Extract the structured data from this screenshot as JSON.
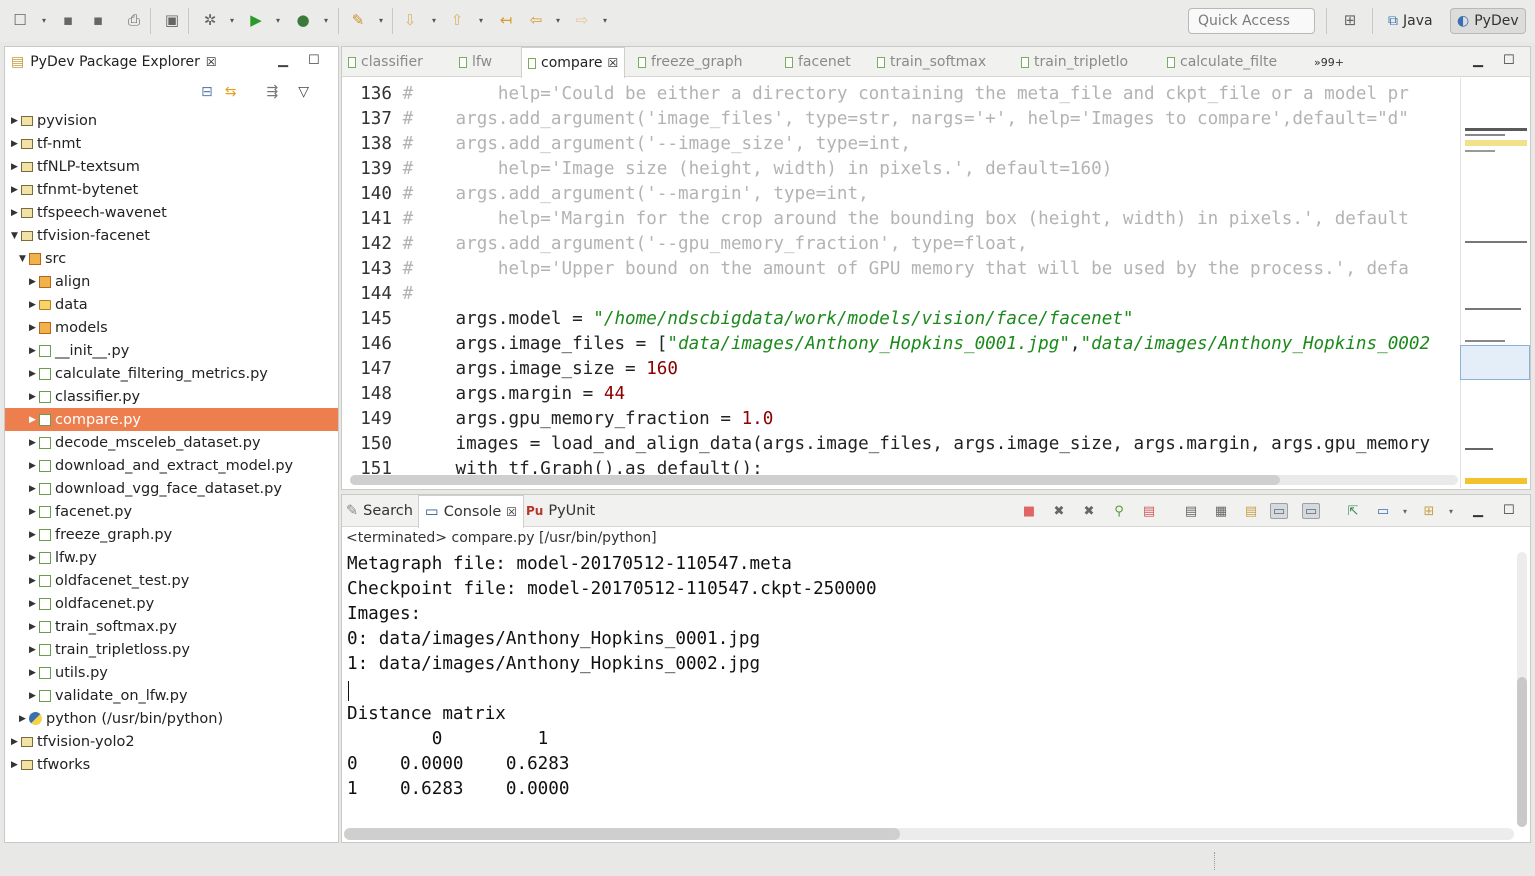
{
  "toolbar": {
    "quick_access_placeholder": "Quick Access",
    "perspectives": [
      {
        "name": "Java",
        "icon": "java-perspective-icon"
      },
      {
        "name": "PyDev",
        "icon": "pydev-perspective-icon",
        "selected": true
      }
    ]
  },
  "explorer": {
    "title": "PyDev Package Explorer",
    "tree": [
      {
        "label": "pyvision",
        "depth": 0,
        "expanded": false,
        "icon": "project"
      },
      {
        "label": "tf-nmt",
        "depth": 0,
        "expanded": false,
        "icon": "project"
      },
      {
        "label": "tfNLP-textsum",
        "depth": 0,
        "expanded": false,
        "icon": "project"
      },
      {
        "label": "tfnmt-bytenet",
        "depth": 0,
        "expanded": false,
        "icon": "project"
      },
      {
        "label": "tfspeech-wavenet",
        "depth": 0,
        "expanded": false,
        "icon": "project"
      },
      {
        "label": "tfvision-facenet",
        "depth": 0,
        "expanded": true,
        "icon": "project"
      },
      {
        "label": "src",
        "depth": 1,
        "expanded": true,
        "icon": "pkg"
      },
      {
        "label": "align",
        "depth": 2,
        "expanded": false,
        "icon": "pkg"
      },
      {
        "label": "data",
        "depth": 2,
        "expanded": false,
        "icon": "folder"
      },
      {
        "label": "models",
        "depth": 2,
        "expanded": false,
        "icon": "pkg"
      },
      {
        "label": "__init__.py",
        "depth": 2,
        "expanded": false,
        "icon": "file"
      },
      {
        "label": "calculate_filtering_metrics.py",
        "depth": 2,
        "expanded": false,
        "icon": "file"
      },
      {
        "label": "classifier.py",
        "depth": 2,
        "expanded": false,
        "icon": "file"
      },
      {
        "label": "compare.py",
        "depth": 2,
        "expanded": false,
        "icon": "file",
        "selected": true
      },
      {
        "label": "decode_msceleb_dataset.py",
        "depth": 2,
        "expanded": false,
        "icon": "file"
      },
      {
        "label": "download_and_extract_model.py",
        "depth": 2,
        "expanded": false,
        "icon": "file"
      },
      {
        "label": "download_vgg_face_dataset.py",
        "depth": 2,
        "expanded": false,
        "icon": "file"
      },
      {
        "label": "facenet.py",
        "depth": 2,
        "expanded": false,
        "icon": "file"
      },
      {
        "label": "freeze_graph.py",
        "depth": 2,
        "expanded": false,
        "icon": "file"
      },
      {
        "label": "lfw.py",
        "depth": 2,
        "expanded": false,
        "icon": "file"
      },
      {
        "label": "oldfacenet_test.py",
        "depth": 2,
        "expanded": false,
        "icon": "file"
      },
      {
        "label": "oldfacenet.py",
        "depth": 2,
        "expanded": false,
        "icon": "file"
      },
      {
        "label": "train_softmax.py",
        "depth": 2,
        "expanded": false,
        "icon": "file"
      },
      {
        "label": "train_tripletloss.py",
        "depth": 2,
        "expanded": false,
        "icon": "file"
      },
      {
        "label": "utils.py",
        "depth": 2,
        "expanded": false,
        "icon": "file"
      },
      {
        "label": "validate_on_lfw.py",
        "depth": 2,
        "expanded": false,
        "icon": "file"
      },
      {
        "label": "python (/usr/bin/python)",
        "depth": 1,
        "expanded": false,
        "icon": "python"
      },
      {
        "label": "tfvision-yolo2",
        "depth": 0,
        "expanded": false,
        "icon": "project"
      },
      {
        "label": "tfworks",
        "depth": 0,
        "expanded": false,
        "icon": "project"
      }
    ]
  },
  "editor": {
    "tabs": [
      "classifier",
      "lfw",
      "compare",
      "freeze_graph",
      "facenet",
      "train_softmax",
      "train_tripletlo",
      "calculate_filte"
    ],
    "active_tab": "compare",
    "overflow": "»99+",
    "lines": [
      {
        "n": "136",
        "segs": [
          {
            "t": "#        help='Could be either a directory containing the meta_file and ckpt_file or a model pr",
            "c": "cm"
          }
        ]
      },
      {
        "n": "137",
        "segs": [
          {
            "t": "#    args.add_argument('image_files', type=str, nargs='+', help='Images to compare',default=\"d\"",
            "c": "cm"
          }
        ]
      },
      {
        "n": "138",
        "segs": [
          {
            "t": "#    args.add_argument('--image_size', type=int,",
            "c": "cm"
          }
        ]
      },
      {
        "n": "139",
        "segs": [
          {
            "t": "#        help='Image size (height, width) in pixels.', default=160)",
            "c": "cm"
          }
        ]
      },
      {
        "n": "140",
        "segs": [
          {
            "t": "#    args.add_argument('--margin', type=int,",
            "c": "cm"
          }
        ]
      },
      {
        "n": "141",
        "segs": [
          {
            "t": "#        help='Margin for the crop around the bounding box (height, width) in pixels.', default",
            "c": "cm"
          }
        ]
      },
      {
        "n": "142",
        "segs": [
          {
            "t": "#    args.add_argument('--gpu_memory_fraction', type=float,",
            "c": "cm"
          }
        ]
      },
      {
        "n": "143",
        "segs": [
          {
            "t": "#        help='Upper bound on the amount of GPU memory that will be used by the process.', defa",
            "c": "cm"
          }
        ]
      },
      {
        "n": "144",
        "segs": [
          {
            "t": "#",
            "c": "cm"
          }
        ]
      },
      {
        "n": "145",
        "segs": [
          {
            "t": "     args.model = ",
            "c": ""
          },
          {
            "t": "\"/home/ndscbigdata/work/models/vision/face/facenet\"",
            "c": "str"
          }
        ]
      },
      {
        "n": "146",
        "segs": [
          {
            "t": "     args.image_files = [",
            "c": ""
          },
          {
            "t": "\"data/images/Anthony_Hopkins_0001.jpg\"",
            "c": "str"
          },
          {
            "t": ",",
            "c": ""
          },
          {
            "t": "\"data/images/Anthony_Hopkins_0002",
            "c": "str"
          }
        ]
      },
      {
        "n": "147",
        "segs": [
          {
            "t": "     args.image_size = ",
            "c": ""
          },
          {
            "t": "160",
            "c": "num"
          }
        ]
      },
      {
        "n": "148",
        "segs": [
          {
            "t": "     args.margin = ",
            "c": ""
          },
          {
            "t": "44",
            "c": "num"
          }
        ]
      },
      {
        "n": "149",
        "segs": [
          {
            "t": "     args.gpu_memory_fraction = ",
            "c": ""
          },
          {
            "t": "1.0",
            "c": "num"
          }
        ]
      },
      {
        "n": "150",
        "segs": [
          {
            "t": "     images = load_and_align_data(args.image_files, args.image_size, args.margin, args.gpu_memory",
            "c": ""
          }
        ]
      },
      {
        "n": "151",
        "segs": [
          {
            "t": "     with tf.Graph().as_default():",
            "c": ""
          }
        ]
      }
    ]
  },
  "console": {
    "tabs": [
      {
        "label": "Search",
        "icon": "search-icon"
      },
      {
        "label": "Console",
        "icon": "console-icon",
        "active": true
      },
      {
        "label": "PyUnit",
        "icon": "pyunit-icon"
      }
    ],
    "terminated": "<terminated> compare.py [/usr/bin/python]",
    "output": [
      "Metagraph file: model-20170512-110547.meta",
      "Checkpoint file: model-20170512-110547.ckpt-250000",
      "Images:",
      "0: data/images/Anthony_Hopkins_0001.jpg",
      "1: data/images/Anthony_Hopkins_0002.jpg",
      "",
      "Distance matrix",
      "        0         1",
      "0    0.0000    0.6283",
      "1    0.6283    0.0000"
    ]
  }
}
